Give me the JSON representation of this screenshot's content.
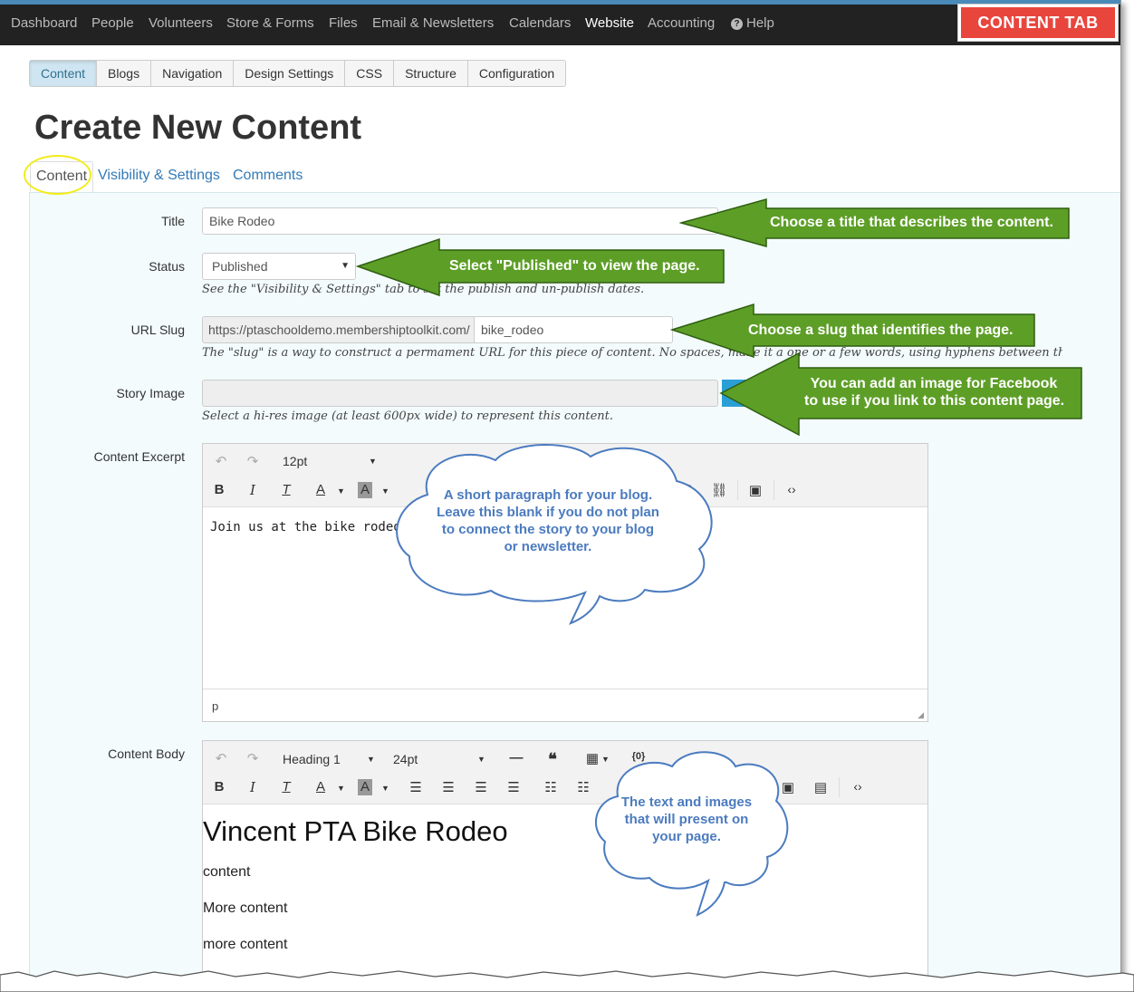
{
  "topnav": {
    "items": [
      "Dashboard",
      "People",
      "Volunteers",
      "Store & Forms",
      "Files",
      "Email & Newsletters",
      "Calendars",
      "Website",
      "Accounting",
      "Help"
    ],
    "active": "Website"
  },
  "badge": {
    "label": "CONTENT TAB",
    "color": "#e8453c"
  },
  "subnav": {
    "items": [
      "Content",
      "Blogs",
      "Navigation",
      "Design Settings",
      "CSS",
      "Structure",
      "Configuration"
    ],
    "active": "Content"
  },
  "page": {
    "title": "Create New Content"
  },
  "tabs": [
    "Content",
    "Visibility & Settings",
    "Comments"
  ],
  "form": {
    "title_label": "Title",
    "title_value": "Bike Rodeo",
    "status_label": "Status",
    "status_value": "Published",
    "status_help": "See the \"Visibility & Settings\" tab to set the publish and un-publish dates.",
    "slug_label": "URL Slug",
    "slug_prefix": "https://ptaschooldemo.membershiptoolkit.com/",
    "slug_value": "bike_rodeo",
    "slug_help": "The \"slug\" is a way to construct a permament URL for this piece of content. No spaces, make it a one or a few words, using hyphens between the words.",
    "image_label": "Story Image",
    "image_help": "Select a hi-res image (at least 600px wide) to represent this content.",
    "excerpt_label": "Content Excerpt",
    "excerpt_fontsize": "12pt",
    "excerpt_text": "Join us at the bike rodeo...",
    "excerpt_status": "p",
    "body_label": "Content Body",
    "body_block": "Heading 1",
    "body_fontsize": "24pt",
    "body_heading": "Vincent PTA Bike Rodeo",
    "body_lines": [
      "content",
      "More content",
      "more content"
    ]
  },
  "annotations": {
    "title": "Choose a title that describes the content.",
    "status": "Select \"Published\" to view the page.",
    "slug": "Choose a slug that identifies the page.",
    "image": [
      "You can add an image for Facebook",
      "to use if you link to this content page."
    ],
    "excerpt": [
      "A short paragraph for your blog.",
      "Leave this blank if you do not plan",
      "to connect the story to your blog",
      "or newsletter."
    ],
    "body": [
      "The text and images",
      "that will present on",
      "your page."
    ],
    "arrow_color": "#5d9e27",
    "cloud_text_color": "#4b7bbf"
  }
}
